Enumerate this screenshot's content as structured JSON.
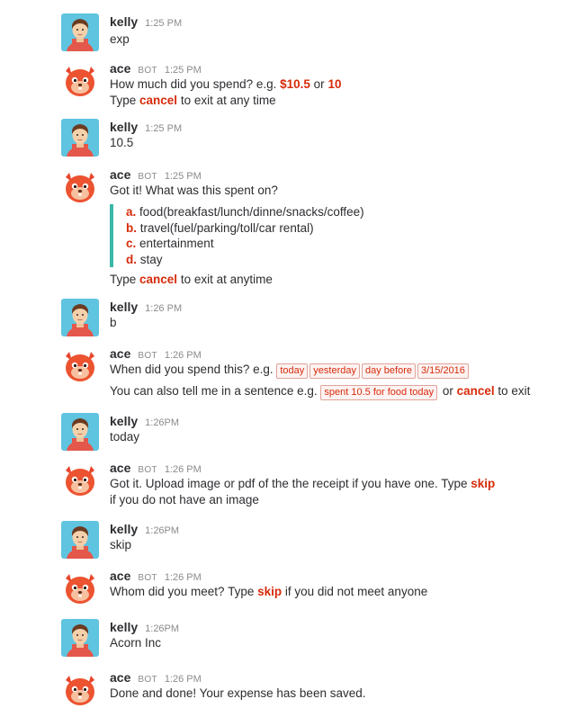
{
  "messages": [
    {
      "user": "kelly",
      "time": "1:25 PM",
      "lines": [
        "exp"
      ]
    },
    {
      "user": "ace",
      "bot": "BOT",
      "time": "1:25 PM",
      "l1_pre": "How much did you spend? e.g. ",
      "l1_h1": "$10.5",
      "l1_mid": " or ",
      "l1_h2": "10",
      "l2_pre": "Type ",
      "l2_h": "cancel",
      "l2_post": " to exit at any time"
    },
    {
      "user": "kelly",
      "time": "1:25 PM",
      "lines": [
        "10.5"
      ]
    },
    {
      "user": "ace",
      "bot": "BOT",
      "time": "1:25 PM",
      "intro": "Got it! What was this spent on?",
      "options": [
        {
          "key": "a.",
          "text": " food(breakfast/lunch/dinne/snacks/coffee)"
        },
        {
          "key": "b.",
          "text": " travel(fuel/parking/toll/car rental)"
        },
        {
          "key": "c.",
          "text": " entertainment"
        },
        {
          "key": "d.",
          "text": " stay"
        }
      ],
      "out_pre": "Type ",
      "out_h": "cancel",
      "out_post": " to exit at anytime"
    },
    {
      "user": "kelly",
      "time": "1:26 PM",
      "lines": [
        "b"
      ]
    },
    {
      "user": "ace",
      "bot": "BOT",
      "time": "1:26 PM",
      "l1_pre": "When did you spend this? e.g. ",
      "chips": [
        "today",
        "yesterday",
        "day before",
        "3/15/2016"
      ],
      "l2_pre": "You can also tell me in a sentence  e.g. ",
      "l2_chip": "spent 10.5 for food today",
      "l2_mid": "  or ",
      "l2_h": "cancel",
      "l2_post": " to exit"
    },
    {
      "user": "kelly",
      "time": "1:26PM",
      "lines": [
        "today"
      ]
    },
    {
      "user": "ace",
      "bot": "BOT",
      "time": "1:26 PM",
      "l1_pre": "Got it. Upload image or pdf of the the receipt if you have one.  Type ",
      "l1_h": "skip",
      "l2": "if you do not have an image"
    },
    {
      "user": "kelly",
      "time": "1:26PM",
      "lines": [
        "skip"
      ]
    },
    {
      "user": "ace",
      "bot": "BOT",
      "time": "1:26 PM",
      "l1_pre": "Whom did you meet?  Type ",
      "l1_h": "skip",
      "l1_post": " if you did not meet anyone"
    },
    {
      "user": "kelly",
      "time": "1:26PM",
      "lines": [
        "Acorn Inc"
      ]
    },
    {
      "user": "ace",
      "bot": "BOT",
      "time": "1:26 PM",
      "lines": [
        "Done and done! Your expense has been saved."
      ]
    }
  ]
}
